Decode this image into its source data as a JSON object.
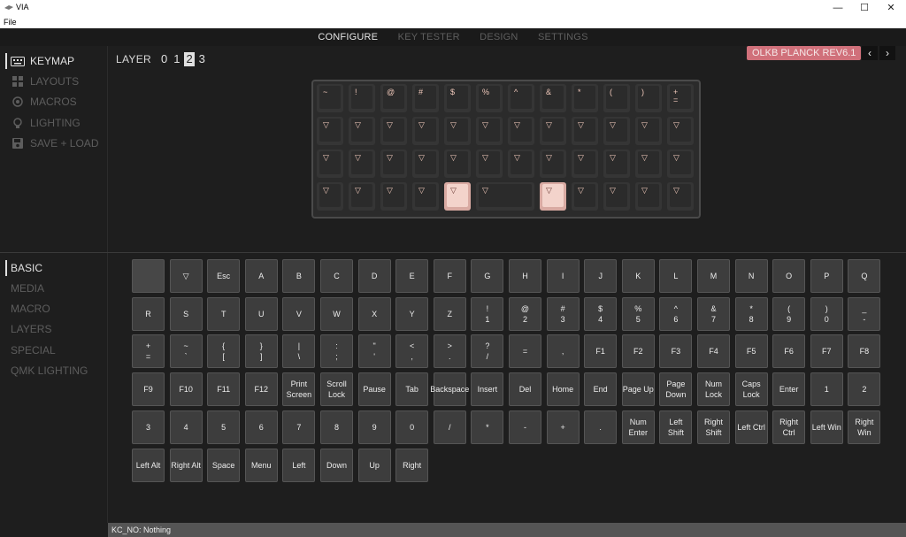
{
  "app": {
    "title": "VIA"
  },
  "menu": {
    "file": "File"
  },
  "window_controls": {
    "minimize": "—",
    "maximize": "☐",
    "close": "✕"
  },
  "topnav": {
    "tabs": [
      "CONFIGURE",
      "KEY TESTER",
      "DESIGN",
      "SETTINGS"
    ],
    "active": 0
  },
  "sidebar_top": [
    {
      "label": "KEYMAP",
      "icon": "keyboard-icon",
      "active": true
    },
    {
      "label": "LAYOUTS",
      "icon": "grid-icon",
      "active": false
    },
    {
      "label": "MACROS",
      "icon": "record-icon",
      "active": false
    },
    {
      "label": "LIGHTING",
      "icon": "bulb-icon",
      "active": false
    },
    {
      "label": "SAVE + LOAD",
      "icon": "save-icon",
      "active": false
    }
  ],
  "sidebar_bottom": [
    {
      "label": "BASIC",
      "active": true
    },
    {
      "label": "MEDIA",
      "active": false
    },
    {
      "label": "MACRO",
      "active": false
    },
    {
      "label": "LAYERS",
      "active": false
    },
    {
      "label": "SPECIAL",
      "active": false
    },
    {
      "label": "QMK LIGHTING",
      "active": false
    }
  ],
  "layer": {
    "label": "LAYER",
    "numbers": [
      "0",
      "1",
      "2",
      "3"
    ],
    "active": 2
  },
  "device": {
    "name": "OLKB PLANCK REV6.1",
    "prev": "‹",
    "next": "›"
  },
  "keyboard": {
    "rows": [
      [
        "~",
        "!",
        "@",
        "#",
        "$",
        "%",
        "^",
        "&",
        "*",
        "(",
        ")",
        "+\n="
      ],
      [
        "▽",
        "▽",
        "▽",
        "▽",
        "▽",
        "▽",
        "▽",
        "▽",
        "▽",
        "▽",
        "▽",
        "▽"
      ],
      [
        "▽",
        "▽",
        "▽",
        "▽",
        "▽",
        "▽",
        "▽",
        "▽",
        "▽",
        "▽",
        "▽",
        "▽"
      ],
      [
        "▽",
        "▽",
        "▽",
        "▽",
        "▽",
        "▽",
        "▽",
        "▽",
        "▽",
        "▽",
        "▽"
      ]
    ],
    "selected": [
      [
        3,
        4
      ],
      [
        3,
        6
      ]
    ]
  },
  "key_grid": [
    [
      "",
      "▽",
      "Esc",
      "A",
      "B",
      "C",
      "D",
      "E",
      "F",
      "G",
      "H",
      "I",
      "J",
      "K",
      "L",
      "M",
      "N",
      "O",
      "P",
      "Q"
    ],
    [
      "R",
      "S",
      "T",
      "U",
      "V",
      "W",
      "X",
      "Y",
      "Z",
      "!\n1",
      "@\n2",
      "#\n3",
      "$\n4",
      "%\n5",
      "^\n6",
      "&\n7",
      "*\n8",
      "(\n9",
      ")\n0",
      "_\n-"
    ],
    [
      "+\n=",
      "~\n`",
      "{\n[",
      "}\n]",
      "|\n\\",
      ":\n;",
      "\"\n'",
      "<\n,",
      ">\n.",
      "?\n/",
      "=",
      ",",
      "F1",
      "F2",
      "F3",
      "F4",
      "F5",
      "F6",
      "F7",
      "F8"
    ],
    [
      "F9",
      "F10",
      "F11",
      "F12",
      "Print\nScreen",
      "Scroll\nLock",
      "Pause",
      "Tab",
      "Backspace",
      "Insert",
      "Del",
      "Home",
      "End",
      "Page Up",
      "Page\nDown",
      "Num\nLock",
      "Caps\nLock",
      "Enter",
      "1",
      "2"
    ],
    [
      "3",
      "4",
      "5",
      "6",
      "7",
      "8",
      "9",
      "0",
      "/",
      "*",
      "-",
      "+",
      ".",
      "Num\nEnter",
      "Left\nShift",
      "Right\nShift",
      "Left Ctrl",
      "Right\nCtrl",
      "Left Win",
      "Right\nWin"
    ],
    [
      "Left Alt",
      "Right Alt",
      "Space",
      "Menu",
      "Left",
      "Down",
      "Up",
      "Right"
    ]
  ],
  "status": {
    "text": "KC_NO: Nothing"
  },
  "colors": {
    "accent": "#d0707a",
    "legend": "#f1c9bb",
    "selected": "#f3d3cb",
    "background": "#1e1e1e"
  }
}
